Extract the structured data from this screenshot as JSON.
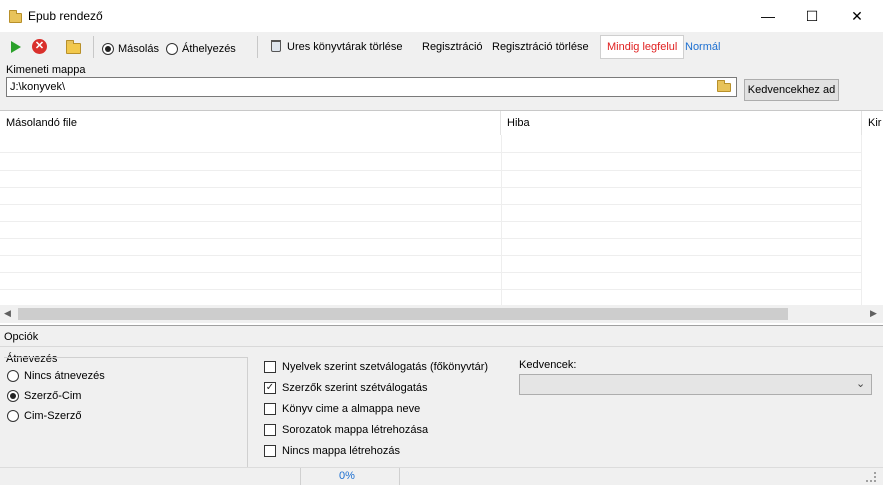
{
  "window": {
    "title": "Epub rendező",
    "controls": {
      "minimize": "—",
      "maximize": "☐",
      "close": "✕"
    }
  },
  "toolbar": {
    "start_icon": "play-icon",
    "stop_icon": "stop-icon",
    "open_icon": "folder-open-icon",
    "copy_label": "Másolás",
    "copy_selected": true,
    "move_label": "Áthelyezés",
    "move_selected": false,
    "clear_empty_label": "Ures könyvtárak törlése",
    "register_label": "Regisztráció",
    "unregister_label": "Regisztráció törlése",
    "always_on_top_label": "Mindig legfelul",
    "normal_label": "Normál",
    "colors": {
      "always_on_top": "#e02020",
      "normal": "#1c6fd1"
    }
  },
  "output": {
    "label": "Kimeneti mappa",
    "path_value": "J:\\konyvek\\",
    "add_favorite_label": "Kedvencekhez ad"
  },
  "grid": {
    "columns": [
      "Másolandó file",
      "Hiba",
      "Kir"
    ],
    "rows": []
  },
  "options": {
    "section_label": "Opciók",
    "rename": {
      "group_label": "Átnevezés",
      "items": [
        {
          "label": "Nincs átnevezés",
          "selected": false
        },
        {
          "label": "Szerző-Cim",
          "selected": true
        },
        {
          "label": "Cim-Szerző",
          "selected": false
        }
      ]
    },
    "checkboxes": [
      {
        "label": "Nyelvek szerint szetválogatás (főkönyvtár)",
        "checked": false
      },
      {
        "label": "Szerzők szerint szétválogatás",
        "checked": true
      },
      {
        "label": "Könyv cime a almappa neve",
        "checked": false
      },
      {
        "label": "Sorozatok mappa létrehozása",
        "checked": false
      },
      {
        "label": "Nincs mappa létrehozás",
        "checked": false
      }
    ],
    "favorites_label": "Kedvencek:",
    "favorites_value": ""
  },
  "status": {
    "progress_text": "0%",
    "progress": 0
  }
}
